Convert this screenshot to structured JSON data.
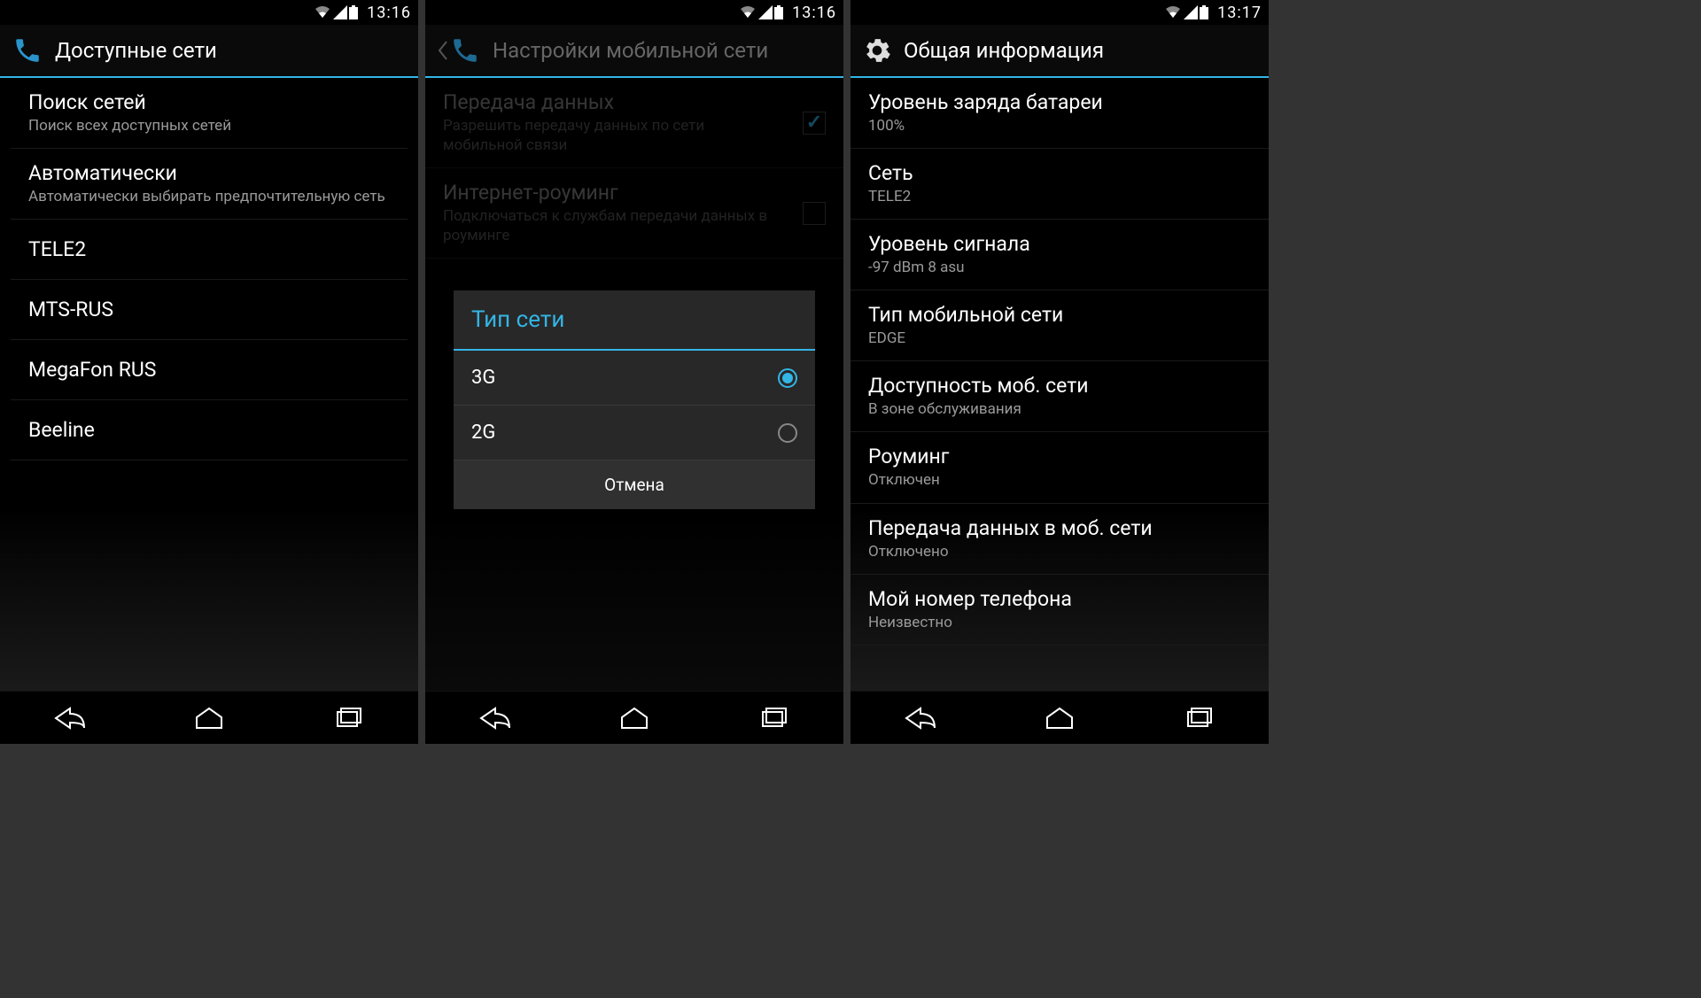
{
  "screen1": {
    "time": "13:16",
    "header": "Доступные сети",
    "items": [
      {
        "title": "Поиск сетей",
        "sub": "Поиск всех доступных сетей"
      },
      {
        "title": "Автоматически",
        "sub": "Автоматически выбирать предпочтительную сеть"
      }
    ],
    "networks": [
      "TELE2",
      "MTS-RUS",
      "MegaFon RUS",
      "Beeline"
    ]
  },
  "screen2": {
    "time": "13:16",
    "header": "Настройки мобильной сети",
    "bg_items": [
      {
        "title": "Передача данных",
        "sub": "Разрешить передачу данных по сети мобильной связи",
        "checked": true
      },
      {
        "title": "Интернет-роуминг",
        "sub": "Подключаться к службам передачи данных в роуминге",
        "checked": false
      }
    ],
    "dialog": {
      "title": "Тип сети",
      "options": [
        {
          "label": "3G",
          "selected": true
        },
        {
          "label": "2G",
          "selected": false
        }
      ],
      "cancel": "Отмена"
    }
  },
  "screen3": {
    "time": "13:17",
    "header": "Общая информация",
    "items": [
      {
        "title": "Уровень заряда батареи",
        "sub": "100%"
      },
      {
        "title": "Сеть",
        "sub": "TELE2"
      },
      {
        "title": "Уровень сигнала",
        "sub": "-97 dBm   8 asu"
      },
      {
        "title": "Тип мобильной сети",
        "sub": "EDGE"
      },
      {
        "title": "Доступность моб. сети",
        "sub": "В зоне обслуживания"
      },
      {
        "title": "Роуминг",
        "sub": "Отключен"
      },
      {
        "title": "Передача данных в моб. сети",
        "sub": "Отключено"
      },
      {
        "title": "Мой номер телефона",
        "sub": "Неизвестно"
      }
    ]
  }
}
